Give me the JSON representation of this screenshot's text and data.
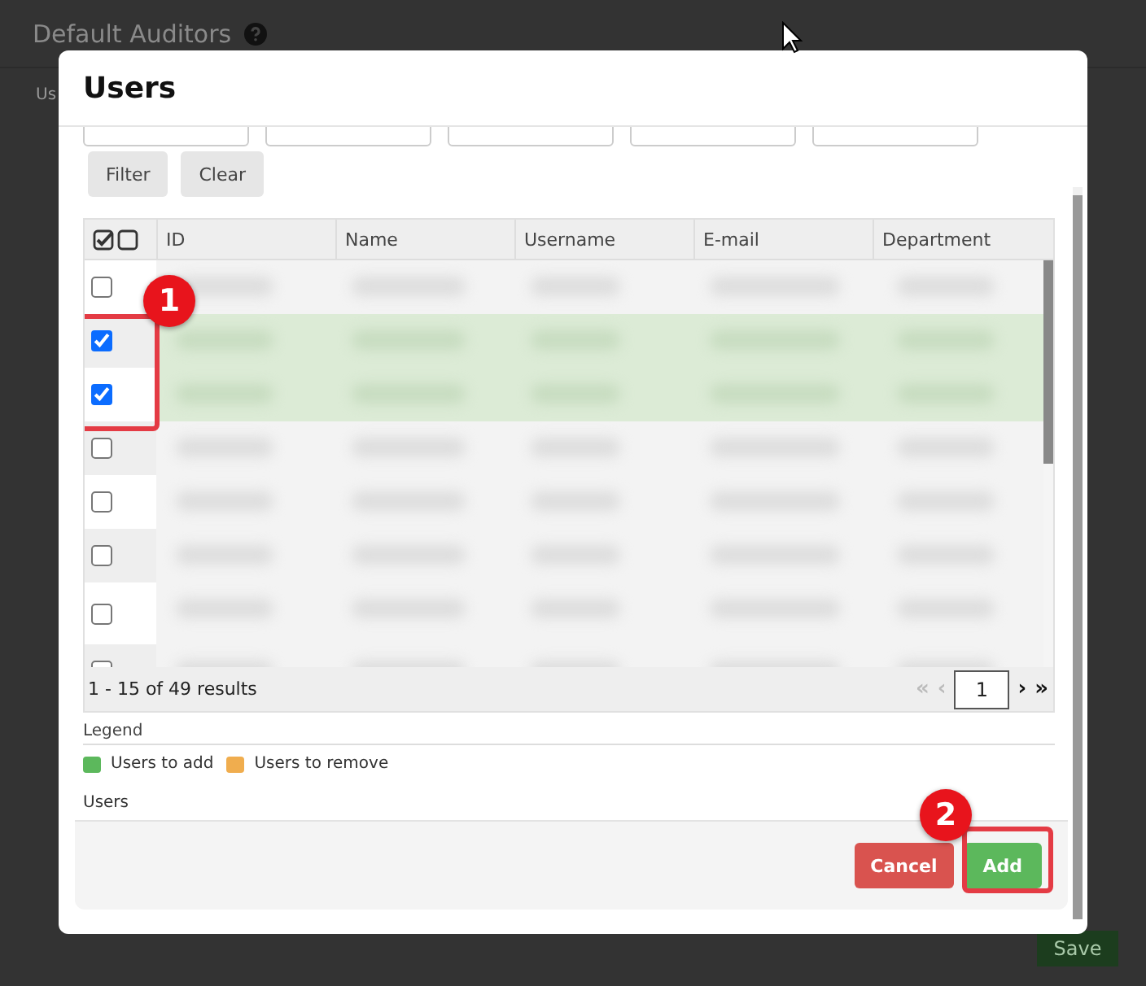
{
  "page": {
    "title": "Default Auditors",
    "label": "Us",
    "save_button": "Save"
  },
  "modal": {
    "title": "Users",
    "filter_button": "Filter",
    "clear_button": "Clear",
    "table": {
      "columns": [
        "ID",
        "Name",
        "Username",
        "E-mail",
        "Department"
      ],
      "rows": [
        {
          "checked": false
        },
        {
          "checked": true
        },
        {
          "checked": true
        },
        {
          "checked": false
        },
        {
          "checked": false
        },
        {
          "checked": false
        },
        {
          "checked": false
        },
        {
          "checked": false
        }
      ],
      "results": "1 - 15 of 49 results",
      "pagination": [
        {
          "label": "«",
          "disabled": true
        },
        {
          "label": "‹",
          "disabled": true
        },
        {
          "label": "1",
          "kind": "page"
        },
        {
          "label": "›",
          "disabled": false
        },
        {
          "label": "»",
          "disabled": false
        }
      ]
    },
    "legend": {
      "title": "Legend",
      "items": [
        {
          "label": "Users to add",
          "color": "#5cb85c"
        },
        {
          "label": "Users to remove",
          "color": "#f0ad4e"
        }
      ]
    },
    "users_label": "Users",
    "cancel_button": "Cancel",
    "add_button": "Add"
  },
  "annotations": [
    "1",
    "2"
  ]
}
